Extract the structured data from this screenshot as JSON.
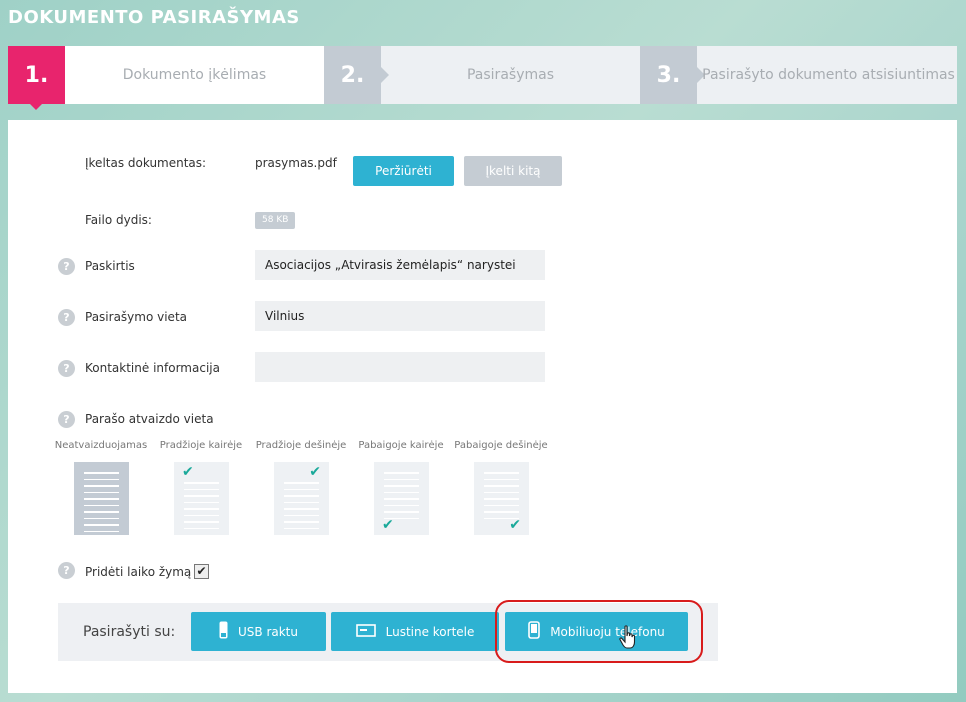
{
  "page": {
    "title": "DOKUMENTO PASIRAŠYMAS"
  },
  "steps": [
    {
      "number": "1.",
      "label": "Dokumento įkėlimas"
    },
    {
      "number": "2.",
      "label": "Pasirašymas"
    },
    {
      "number": "3.",
      "label": "Pasirašyto dokumento atsisiuntimas"
    }
  ],
  "document": {
    "uploaded_label": "Įkeltas dokumentas:",
    "filename": "prasymas.pdf",
    "view_button": "Peržiūrėti",
    "upload_other_button": "Įkelti kitą",
    "size_label": "Failo dydis:",
    "size_value": "58 KB"
  },
  "fields": {
    "purpose_label": "Paskirtis",
    "purpose_value": "Asociacijos „Atvirasis žemėlapis“ narystei",
    "location_label": "Pasirašymo vieta",
    "location_value": "Vilnius",
    "contact_label": "Kontaktinė informacija",
    "contact_value": ""
  },
  "signature_position": {
    "label": "Parašo atvaizdo vieta",
    "options": [
      "Neatvaizduojamas",
      "Pradžioje kairėje",
      "Pradžioje dešinėje",
      "Pabaigoje kairėje",
      "Pabaigoje dešinėje"
    ],
    "selected": "Neatvaizduojamas"
  },
  "timestamp": {
    "label": "Pridėti laiko žymą",
    "checked": true,
    "check_glyph": "✔"
  },
  "sign": {
    "label": "Pasirašyti su:",
    "usb_button": "USB raktu",
    "card_button": "Lustine kortele",
    "mobile_button": "Mobiliuoju telefonu"
  },
  "help_glyph": "?",
  "check_glyph": "✔",
  "colors": {
    "accent": "#e8246d",
    "button": "#2eb2d2",
    "check": "#1aa99a",
    "highlight": "#d81b1b"
  },
  "icons": [
    "usb-icon",
    "card-icon",
    "phone-icon",
    "cursor-hand-icon",
    "help-icon",
    "checkmark-icon"
  ]
}
